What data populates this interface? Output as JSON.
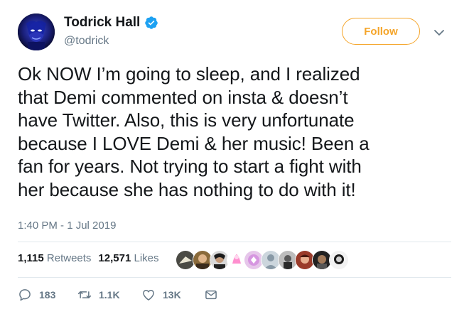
{
  "user": {
    "display_name": "Todrick Hall",
    "handle": "@todrick",
    "verified": true
  },
  "follow_label": "Follow",
  "tweet": {
    "lines": [
      "Ok NOW I’m going to sleep, and I realized",
      "that Demi commented on insta & doesn’t",
      "have Twitter. Also, this is very unfortunate",
      "because I LOVE Demi & her music! Been a",
      "fan for years. Not trying to start a fight with",
      "her because she has nothing to do with it!"
    ],
    "timestamp": "1:40 PM - 1 Jul 2019"
  },
  "stats": {
    "retweets_count": "1,115",
    "retweets_label": "Retweets",
    "likes_count": "12,571",
    "likes_label": "Likes"
  },
  "actions": {
    "replies": "183",
    "retweets": "1.1K",
    "likes": "13K"
  },
  "colors": {
    "accent": "#f5a52a",
    "verified": "#1da1f2",
    "muted": "#657786",
    "text": "#14171a"
  }
}
